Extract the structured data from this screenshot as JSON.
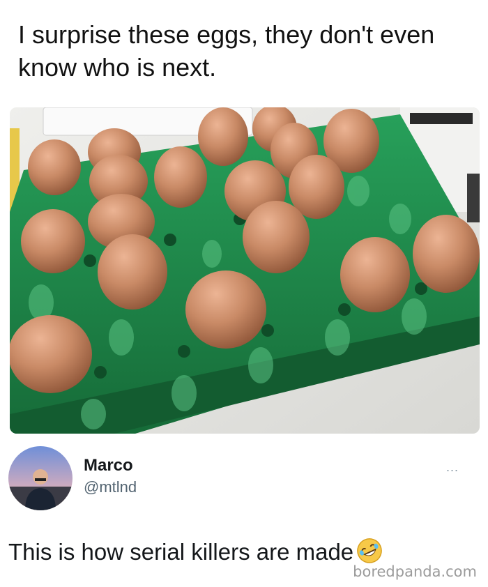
{
  "post": {
    "text": "I surprise these eggs, they don't even know who is next."
  },
  "author": {
    "name": "Marco",
    "handle": "@mtlnd",
    "more_label": "..."
  },
  "reply": {
    "text": "This is how serial killers are made"
  },
  "watermark": {
    "text": "boredpanda.com"
  },
  "colors": {
    "tray": "#1e8a4a",
    "egg": "#c98a66",
    "handle": "#536471"
  },
  "icons": {
    "emoji": "rolling-on-floor-laughing-emoji",
    "more": "more-options-icon"
  }
}
